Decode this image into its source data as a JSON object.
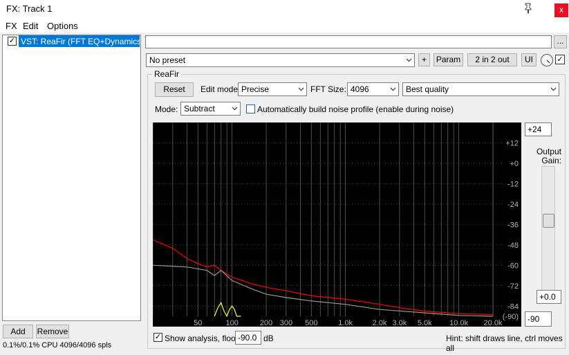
{
  "window": {
    "title": "FX: Track 1",
    "close_glyph": "x"
  },
  "menu": [
    "FX",
    "Edit",
    "Options"
  ],
  "fx_chain": {
    "items": [
      {
        "label": "VST: ReaFir (FFT EQ+Dynamics ...",
        "enabled": true
      }
    ],
    "add_label": "Add",
    "remove_label": "Remove",
    "cpu_text": "0.1%/0.1% CPU 4096/4096 spls"
  },
  "header": {
    "name_value": "",
    "more_label": "...",
    "preset": "No preset",
    "plus_label": "+",
    "param_label": "Param",
    "io_label": "2 in 2 out",
    "ui_label": "UI",
    "bypass_checked": true
  },
  "plugin": {
    "group_title": "ReaFir",
    "reset_label": "Reset",
    "edit_mode_label": "Edit mode:",
    "edit_mode": "Precise",
    "fft_size_label": "FFT Size:",
    "fft_size": "4096",
    "quality": "Best quality",
    "mode_label": "Mode:",
    "mode": "Subtract",
    "auto_noise_label": "Automatically build noise profile (enable during noise)",
    "auto_noise_checked": false
  },
  "graph": {
    "db_labels": [
      "+12",
      "+0",
      "-12",
      "-24",
      "-36",
      "-48",
      "-60",
      "-72",
      "-84",
      "(-90)"
    ],
    "freq_labels": [
      "50",
      "100",
      "200",
      "300",
      "500",
      "1.0k",
      "2.0k",
      "3.0k",
      "5.0k",
      "10.0k",
      "20.0k"
    ],
    "colors": {
      "background": "#000000",
      "grid": "#6e6e6e",
      "label": "#b4b4b4",
      "analysis": "#ff0000",
      "noise_profile": "#9a9888",
      "filter": "#ffff30"
    }
  },
  "chart_data": {
    "type": "line",
    "xlabel": "",
    "ylabel": "",
    "x_scale": "log",
    "xlim": [
      20,
      24000
    ],
    "ylim": [
      -90,
      24
    ],
    "series": [
      {
        "x": [
          20,
          30,
          40,
          50,
          60,
          70,
          80,
          100,
          150,
          200,
          300,
          500,
          1000,
          2000,
          3000,
          5000,
          10000,
          20000
        ],
        "y": [
          -45,
          -50,
          -56,
          -59,
          -61,
          -60,
          -63,
          -67,
          -71,
          -73,
          -75,
          -78,
          -80,
          -83,
          -85,
          -87,
          -88.5,
          -89
        ]
      },
      {
        "x": [
          20,
          40,
          60,
          70,
          80,
          100,
          150,
          200,
          300,
          500,
          1000,
          2000,
          5000,
          10000,
          20000
        ],
        "y": [
          -60,
          -61,
          -63,
          -66,
          -63,
          -69,
          -74,
          -77,
          -79,
          -81,
          -83,
          -86,
          -88,
          -89.5,
          -90
        ]
      },
      {
        "x": [
          70,
          75,
          80,
          85,
          90,
          95,
          100,
          105,
          110,
          115,
          120
        ],
        "y": [
          -90,
          -85,
          -82,
          -87,
          -90,
          -86,
          -84,
          -86,
          -90,
          -90,
          -90
        ]
      }
    ]
  },
  "output": {
    "db_max": "+24",
    "label_line1": "Output",
    "label_line2": "Gain:",
    "gain_value": "+0.0",
    "gain_fraction": 0.5,
    "db_min": "-90"
  },
  "footer": {
    "show_analysis_label": "Show analysis, floor:",
    "show_analysis_checked": true,
    "floor_value": "-90.0",
    "floor_unit": "dB",
    "hint": "Hint: shift draws line, ctrl moves all"
  }
}
